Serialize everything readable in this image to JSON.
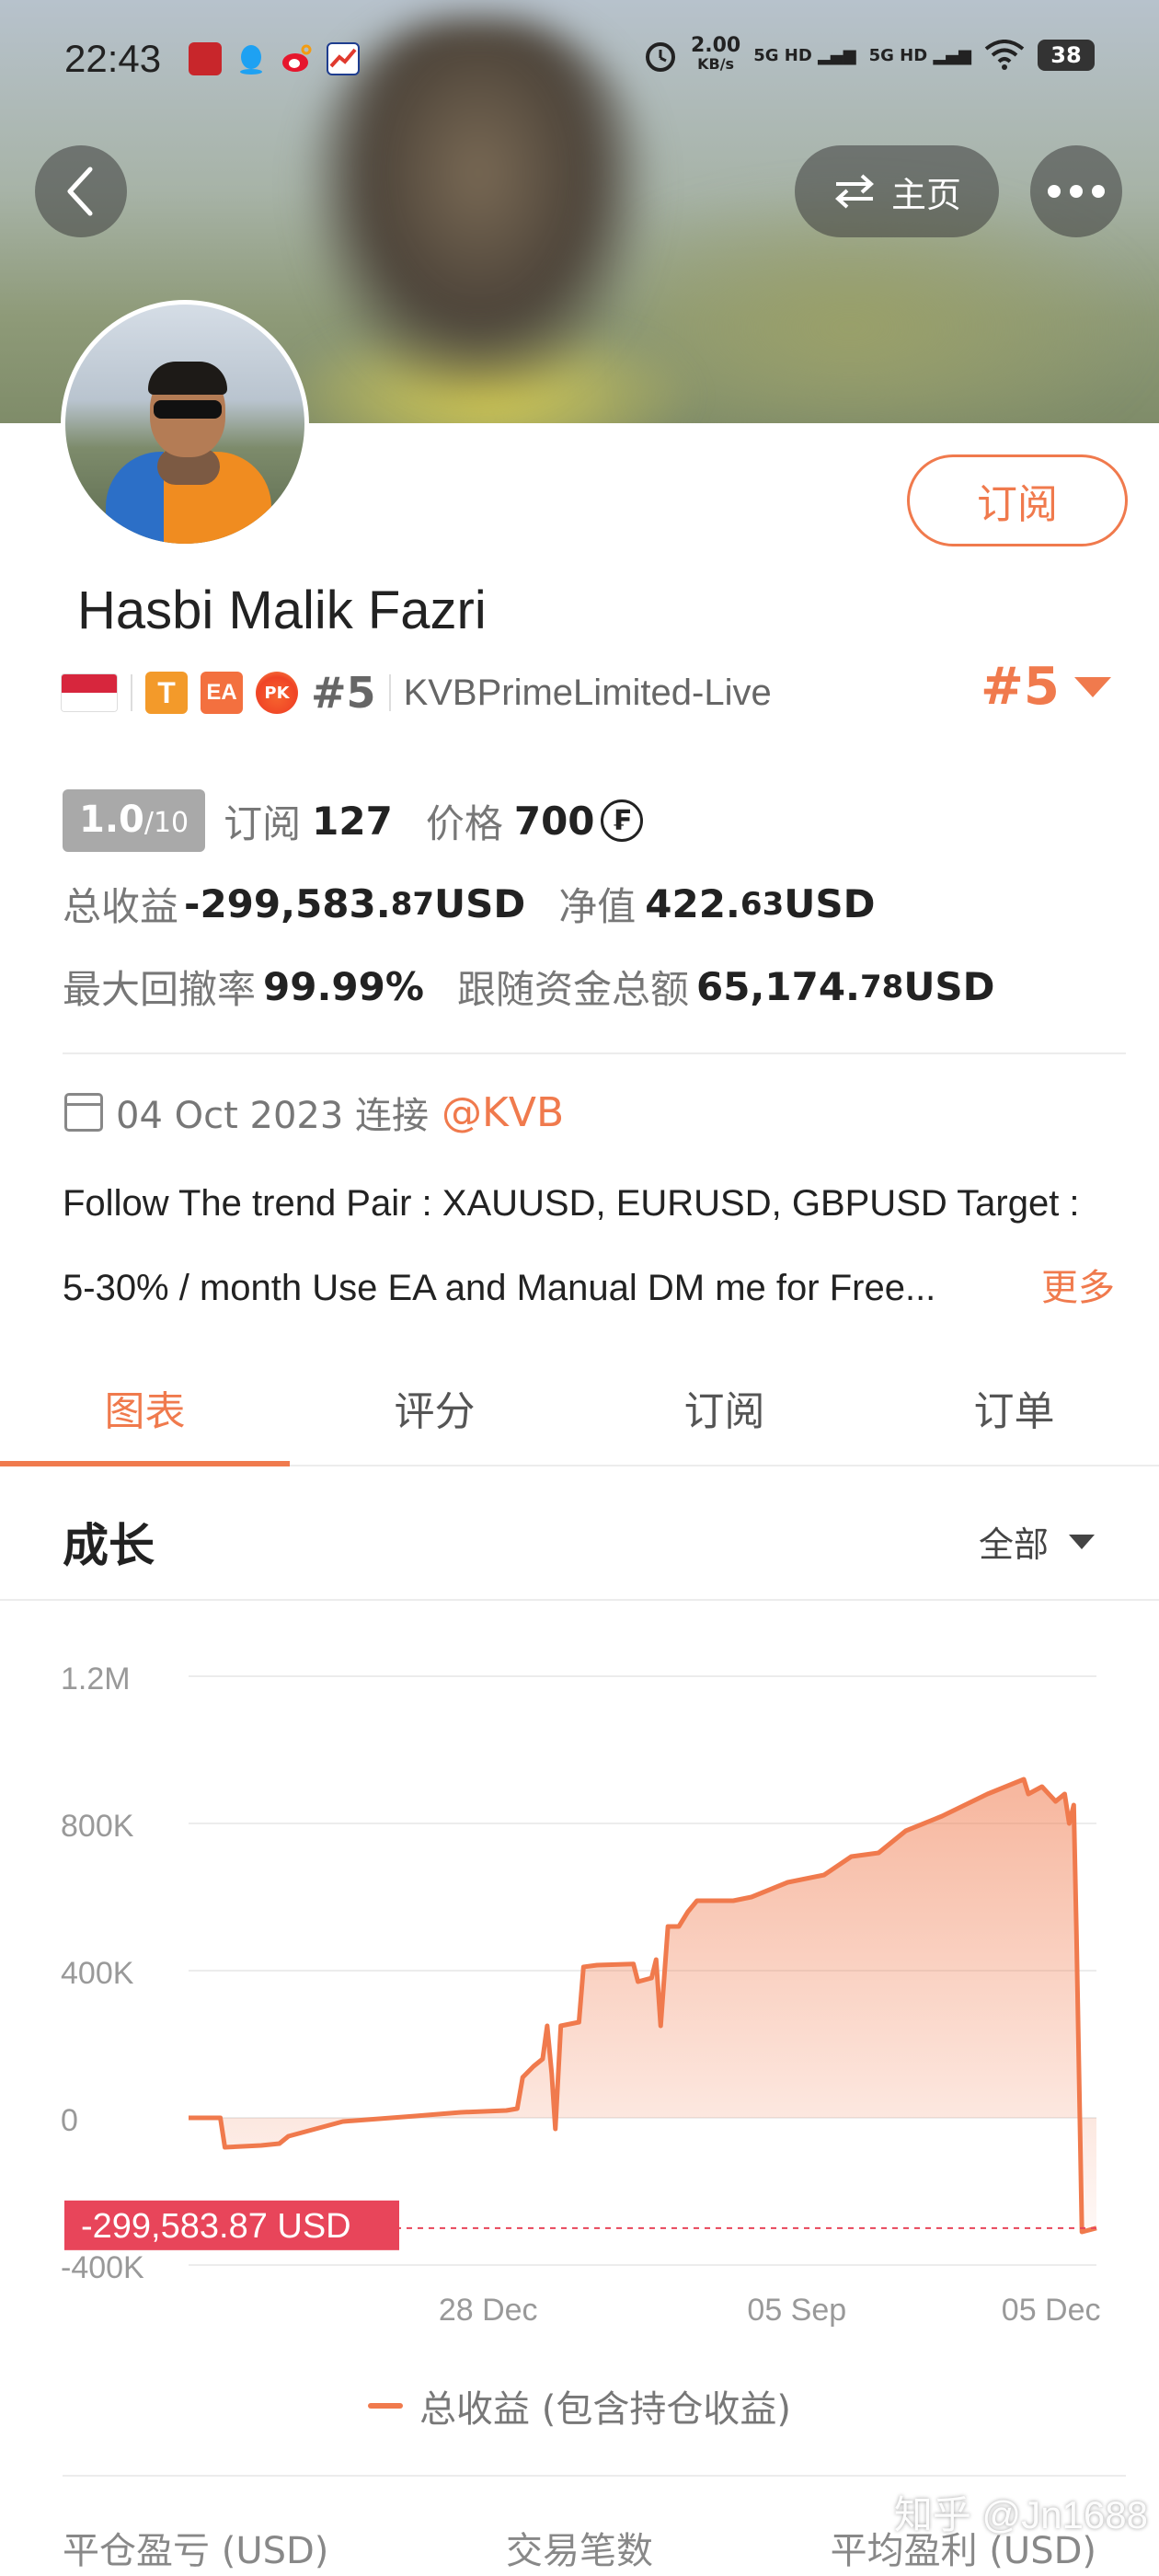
{
  "status_bar": {
    "time": "22:43",
    "net_speed_value": "2.00",
    "net_speed_unit": "KB/s",
    "signal_1": "5G HD",
    "signal_2": "5G HD",
    "battery": "38"
  },
  "header": {
    "home_label": "主页"
  },
  "profile": {
    "subscribe_label": "订阅",
    "name": "Hasbi Malik Fazri",
    "tag_t": "T",
    "tag_ea": "EA",
    "tag_pk": "PK",
    "rank_small": "#5",
    "broker": "KVBPrimeLimited-Live",
    "rank_big": "#5"
  },
  "stats": {
    "leverage_main": "1.0",
    "leverage_sub": "/10",
    "subscribe_label": "订阅",
    "subscribe_count": "127",
    "price_label": "价格",
    "price_value": "700",
    "coin_symbol": "₣",
    "total_profit_label": "总收益",
    "total_profit_main": "-299,583.",
    "total_profit_dec": "87",
    "total_profit_unit": " USD",
    "net_label": "净值",
    "net_main": "422.",
    "net_dec": "63",
    "net_unit": " USD",
    "drawdown_label": "最大回撤率",
    "drawdown_value": "99.99%",
    "follow_funds_label": "跟随资金总额",
    "follow_funds_main": "65,174.",
    "follow_funds_dec": "78",
    "follow_funds_unit": " USD"
  },
  "joined": {
    "date_text": "04 Oct 2023 连接",
    "broker_link": "@KVB"
  },
  "description": {
    "line1": "Follow The trend Pair : XAUUSD, EURUSD, GBPUSD Target :",
    "line2": "5-30% / month Use EA and Manual DM me for Free...",
    "more_label": "更多"
  },
  "tabs": [
    "图表",
    "评分",
    "订阅",
    "订单"
  ],
  "growth": {
    "title": "成长",
    "filter_label": "全部"
  },
  "chart_data": {
    "type": "area",
    "ylim": [
      -400000,
      1200000
    ],
    "y_ticks": [
      "1.2M",
      "800K",
      "400K",
      "0",
      "-400K"
    ],
    "y_tick_values": [
      1200000,
      800000,
      400000,
      0,
      -400000
    ],
    "x_ticks": [
      "28 Dec",
      "05 Sep",
      "05 Dec"
    ],
    "x_tick_positions": [
      0.33,
      0.67,
      0.95
    ],
    "current_value_label": "-299,583.87 USD",
    "current_value": -299583.87,
    "legend": "总收益 (包含持仓收益)",
    "series": [
      {
        "name": "总收益 (包含持仓收益)",
        "points": [
          [
            0.0,
            0
          ],
          [
            0.035,
            0
          ],
          [
            0.04,
            -80000
          ],
          [
            0.08,
            -75000
          ],
          [
            0.1,
            -70000
          ],
          [
            0.11,
            -50000
          ],
          [
            0.17,
            -10000
          ],
          [
            0.25,
            5000
          ],
          [
            0.3,
            15000
          ],
          [
            0.35,
            20000
          ],
          [
            0.362,
            25000
          ],
          [
            0.368,
            110000
          ],
          [
            0.38,
            140000
          ],
          [
            0.39,
            160000
          ],
          [
            0.395,
            250000
          ],
          [
            0.4,
            120000
          ],
          [
            0.404,
            -30000
          ],
          [
            0.41,
            250000
          ],
          [
            0.43,
            260000
          ],
          [
            0.435,
            410000
          ],
          [
            0.45,
            415000
          ],
          [
            0.49,
            418000
          ],
          [
            0.495,
            370000
          ],
          [
            0.51,
            380000
          ],
          [
            0.515,
            430000
          ],
          [
            0.52,
            250000
          ],
          [
            0.528,
            520000
          ],
          [
            0.54,
            520000
          ],
          [
            0.55,
            560000
          ],
          [
            0.56,
            590000
          ],
          [
            0.6,
            590000
          ],
          [
            0.62,
            600000
          ],
          [
            0.66,
            640000
          ],
          [
            0.7,
            660000
          ],
          [
            0.73,
            710000
          ],
          [
            0.76,
            720000
          ],
          [
            0.79,
            780000
          ],
          [
            0.83,
            820000
          ],
          [
            0.88,
            880000
          ],
          [
            0.92,
            920000
          ],
          [
            0.925,
            880000
          ],
          [
            0.94,
            900000
          ],
          [
            0.955,
            860000
          ],
          [
            0.965,
            880000
          ],
          [
            0.97,
            800000
          ],
          [
            0.975,
            850000
          ],
          [
            0.978,
            500000
          ],
          [
            0.984,
            -310000
          ],
          [
            1.0,
            -299583.87
          ]
        ]
      }
    ]
  },
  "bottom_labels": [
    "平仓盈亏 (USD)",
    "交易笔数",
    "平均盈利 (USD)"
  ],
  "watermark": "知乎 @Jn1688",
  "colors": {
    "accent": "#f07a4d",
    "fill": "#fbd3c2",
    "negative_label_bg": "#e8455a"
  }
}
